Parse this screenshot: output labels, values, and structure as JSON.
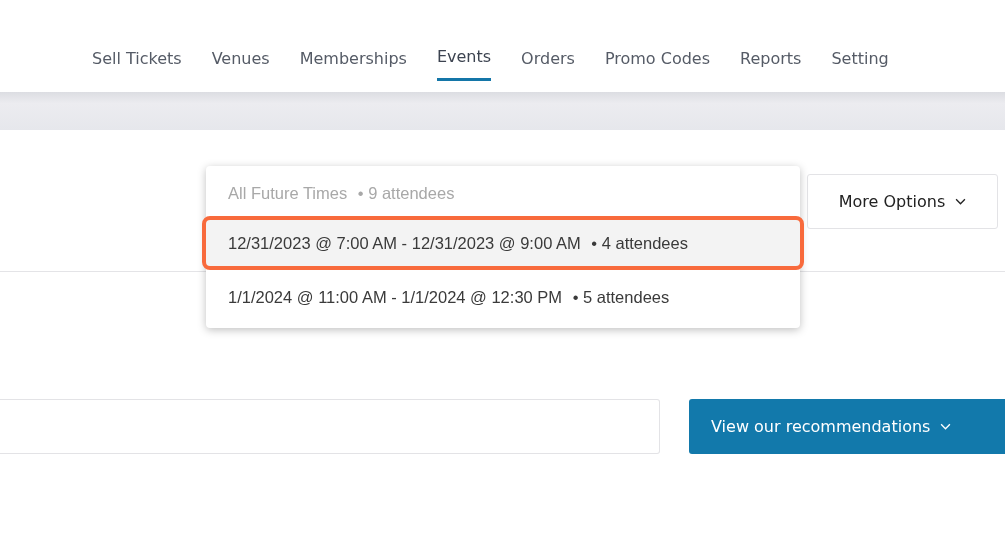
{
  "nav": {
    "tabs": [
      {
        "label": "Sell Tickets",
        "selected": false
      },
      {
        "label": "Venues",
        "selected": false
      },
      {
        "label": "Memberships",
        "selected": false
      },
      {
        "label": "Events",
        "selected": true
      },
      {
        "label": "Orders",
        "selected": false
      },
      {
        "label": "Promo Codes",
        "selected": false
      },
      {
        "label": "Reports",
        "selected": false
      },
      {
        "label": "Setting",
        "selected": false
      }
    ]
  },
  "more_options": {
    "label": "More Options"
  },
  "time_dropdown": {
    "options": [
      {
        "label": "All Future Times",
        "attendees": "• 9 attendees",
        "disabled": true,
        "selected": false
      },
      {
        "label": "12/31/2023 @ 7:00 AM - 12/31/2023 @ 9:00 AM",
        "attendees": "• 4 attendees",
        "disabled": false,
        "selected": true
      },
      {
        "label": "1/1/2024 @ 11:00 AM - 1/1/2024 @ 12:30 PM",
        "attendees": "• 5 attendees",
        "disabled": false,
        "selected": false
      }
    ]
  },
  "recommendations_button": {
    "label": "View our recommendations"
  }
}
